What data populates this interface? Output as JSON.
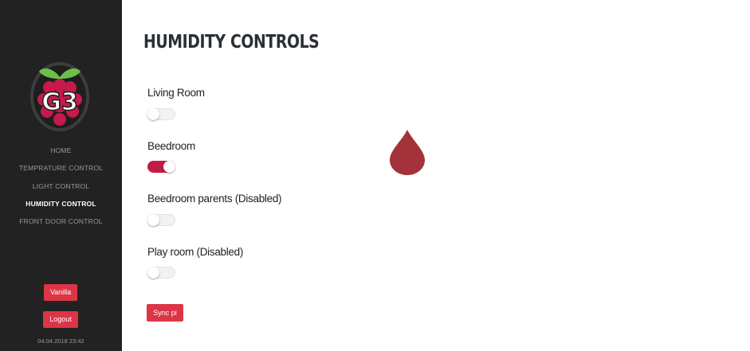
{
  "sidebar": {
    "logo_text": "G3",
    "nav": [
      {
        "label": "HOME",
        "active": false
      },
      {
        "label": "TEMPRATURE CONTROL",
        "active": false
      },
      {
        "label": "LIGHT CONTROL",
        "active": false
      },
      {
        "label": "HUMIDITY CONTROL",
        "active": true
      },
      {
        "label": "FRONT DOOR CONTROL",
        "active": false
      }
    ],
    "user_button": "Vanilla",
    "logout_button": "Logout",
    "datetime": "04.04.2018 23:42"
  },
  "main": {
    "title": "HUMIDITY CONTROLS",
    "controls": [
      {
        "label": "Living Room",
        "on": false
      },
      {
        "label": "Beedroom",
        "on": true
      },
      {
        "label": "Beedroom parents (Disabled)",
        "on": false
      },
      {
        "label": "Play room (Disabled)",
        "on": false
      }
    ],
    "sync_button": "Sync pi",
    "icon": "water-drop-icon"
  },
  "colors": {
    "sidebar_bg": "#222222",
    "accent_red": "#dc3545",
    "switch_on": "#c11d45",
    "drop": "#a3323a",
    "logo_green": "#6cc04a",
    "logo_red": "#c51a4a"
  }
}
